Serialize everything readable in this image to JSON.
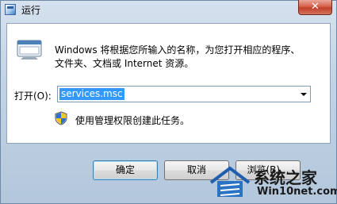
{
  "window": {
    "title": "运行",
    "close_glyph": "✕"
  },
  "description": {
    "line1": "Windows 将根据您所输入的名称，为您打开相应的程序、",
    "line2": "文件夹、文档或 Internet 资源。"
  },
  "open_field": {
    "label": "打开(O):",
    "value": "services.msc"
  },
  "admin_note": "使用管理权限创建此任务。",
  "buttons": {
    "ok": "确定",
    "cancel": "取消",
    "browse": "浏览(B)..."
  },
  "watermark": {
    "brand": "系统之家",
    "url": "Win10net.com"
  },
  "colors": {
    "selection": "#3399ff",
    "frame": "#c2d3e4"
  }
}
